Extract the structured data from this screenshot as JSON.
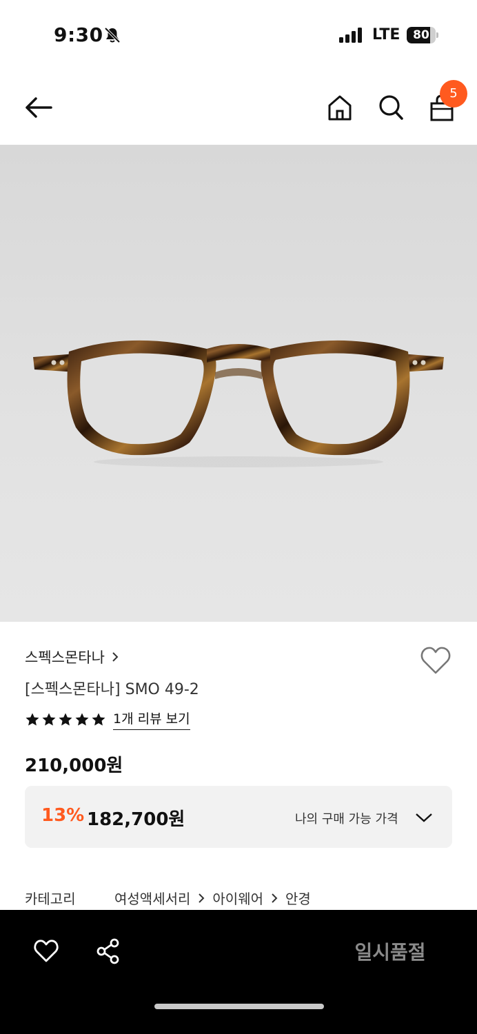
{
  "status_bar": {
    "time": "9:30",
    "network": "LTE",
    "battery": "80",
    "battery_level": 0.8,
    "icons": [
      "bell-slash-icon",
      "signal-icon",
      "battery-icon"
    ]
  },
  "header": {
    "icons": [
      "back-arrow-icon",
      "home-icon",
      "search-icon",
      "shopping-bag-icon"
    ],
    "cart_count": "5"
  },
  "colors": {
    "accent": "#ff5a1f",
    "bottom_bar": "#000000",
    "price_box_bg": "#f2f2f2",
    "sold_out_text": "#8a8a8a"
  },
  "product": {
    "brand": "스펙스몬타나",
    "title": "[스펙스몬타나] SMO 49-2",
    "rating_stars": 5,
    "review_link": "1개 리뷰 보기",
    "original_price": "210,000원",
    "discount_rate": "13%",
    "discount_price": "182,700원",
    "my_price_label": "나의 구매 가능 가격"
  },
  "category": {
    "label": "카테고리",
    "path": [
      "여성액세서리",
      "아이웨어",
      "안경"
    ]
  },
  "bottom_bar": {
    "sold_out_label": "일시품절",
    "icons": [
      "heart-icon",
      "share-icon"
    ]
  }
}
